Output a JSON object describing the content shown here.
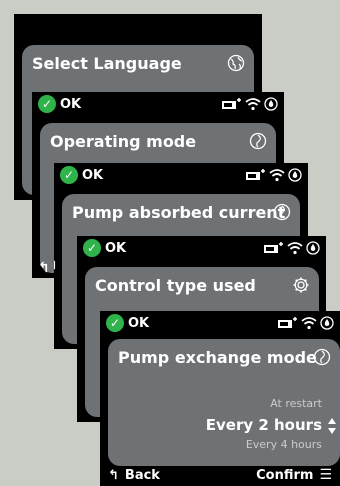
{
  "screens": [
    {
      "title": "Select Language",
      "icon": "globe-icon"
    },
    {
      "status": "OK",
      "title": "Operating mode",
      "icon": "spinner-icon"
    },
    {
      "status": "OK",
      "title": "Pump absorbed current",
      "icon": "spinner-icon"
    },
    {
      "status": "OK",
      "title": "Control type used",
      "icon": "gear-icon"
    },
    {
      "status": "OK",
      "title": "Pump exchange mode",
      "icon": "spinner-icon",
      "picker": {
        "previous": "At restart",
        "selected": "Every 2 hours",
        "next": "Every 4 hours"
      },
      "footer": {
        "back": "Back",
        "confirm": "Confirm"
      }
    }
  ],
  "status_icons": [
    "pump-plus-icon",
    "wifi-icon",
    "water-drop-icon"
  ],
  "colors": {
    "background": "#c9cdc6",
    "screen": "#000000",
    "card": "#6e7275",
    "ok": "#2fb34a"
  }
}
